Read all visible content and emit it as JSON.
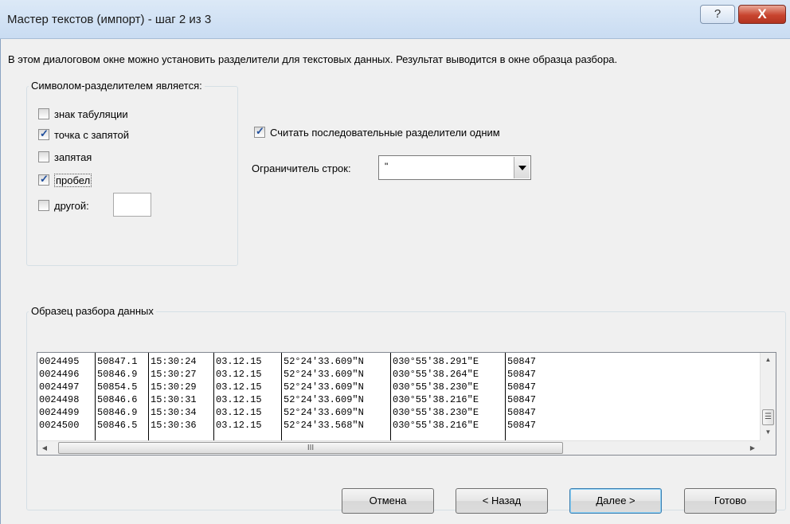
{
  "window": {
    "title": "Мастер текстов (импорт) - шаг 2 из 3",
    "help_glyph": "?",
    "close_glyph": "X"
  },
  "description": "В этом диалоговом окне можно установить разделители для текстовых данных. Результат выводится в окне образца разбора.",
  "delimiters": {
    "legend": "Символом-разделителем является:",
    "options": [
      {
        "label": "знак табуляции",
        "checked": false
      },
      {
        "label": "точка с запятой",
        "checked": true
      },
      {
        "label": "запятая",
        "checked": false
      },
      {
        "label": "пробел",
        "checked": true
      },
      {
        "label": "другой:",
        "checked": false
      }
    ],
    "other_value": ""
  },
  "consecutive": {
    "label": "Считать последовательные разделители одним",
    "checked": true
  },
  "text_qualifier": {
    "label": "Ограничитель строк:",
    "value": "\""
  },
  "preview": {
    "legend": "Образец разбора данных",
    "rows": [
      [
        "0024495",
        "50847.1",
        "15:30:24",
        "03.12.15",
        "52°24'33.609\"N",
        "030°55'38.291\"E",
        "50847"
      ],
      [
        "0024496",
        "50846.9",
        "15:30:27",
        "03.12.15",
        "52°24'33.609\"N",
        "030°55'38.264\"E",
        "50847"
      ],
      [
        "0024497",
        "50854.5",
        "15:30:29",
        "03.12.15",
        "52°24'33.609\"N",
        "030°55'38.230\"E",
        "50847"
      ],
      [
        "0024498",
        "50846.6",
        "15:30:31",
        "03.12.15",
        "52°24'33.609\"N",
        "030°55'38.216\"E",
        "50847"
      ],
      [
        "0024499",
        "50846.9",
        "15:30:34",
        "03.12.15",
        "52°24'33.609\"N",
        "030°55'38.230\"E",
        "50847"
      ],
      [
        "0024500",
        "50846.5",
        "15:30:36",
        "03.12.15",
        "52°24'33.568\"N",
        "030°55'38.216\"E",
        "50847"
      ]
    ],
    "hscroll_glyph": "III",
    "vscroll_glyph": "☰"
  },
  "buttons": {
    "cancel": "Отмена",
    "back": "< Назад",
    "next": "Далее >",
    "finish": "Готово"
  }
}
